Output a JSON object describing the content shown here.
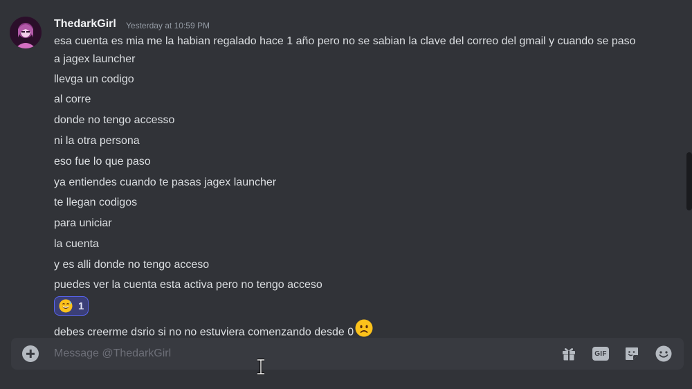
{
  "message": {
    "author": "ThedarkGirl",
    "timestamp": "Yesterday at 10:59 PM",
    "lines": [
      "esa cuenta es mia me la habian regalado hace 1 año pero no se sabian la clave del correo del gmail y  cuando se paso a jagex launcher",
      "llevga un codigo",
      "al corre",
      "donde no tengo accesso",
      "ni la otra persona",
      "eso fue lo que paso",
      "ya entiendes cuando te pasas  jagex launcher",
      "te llegan codigos",
      "para uniciar",
      "la cuenta",
      "y es alli donde no tengo acceso",
      "puedes ver la cuenta esta activa pero no tengo acceso"
    ],
    "reaction": {
      "emoji": "grinning-sweat-emoji",
      "count": "1"
    },
    "last_line": "debes creerme dsrio si no no estuviera comenzando desde 0",
    "last_line_emoji": "frowning-face-emoji"
  },
  "composer": {
    "placeholder": "Message @ThedarkGirl",
    "gif_label": "GIF",
    "icons": [
      "add-circle-icon",
      "gift-icon",
      "gif-icon",
      "sticker-icon",
      "emoji-icon"
    ]
  },
  "colors": {
    "background": "#313338",
    "composer": "#383a40",
    "text": "#dbdee1",
    "username": "#f2f3f5",
    "muted": "#949ba4",
    "reaction_border": "#5865f2",
    "reaction_bg": "#3b3f77"
  }
}
